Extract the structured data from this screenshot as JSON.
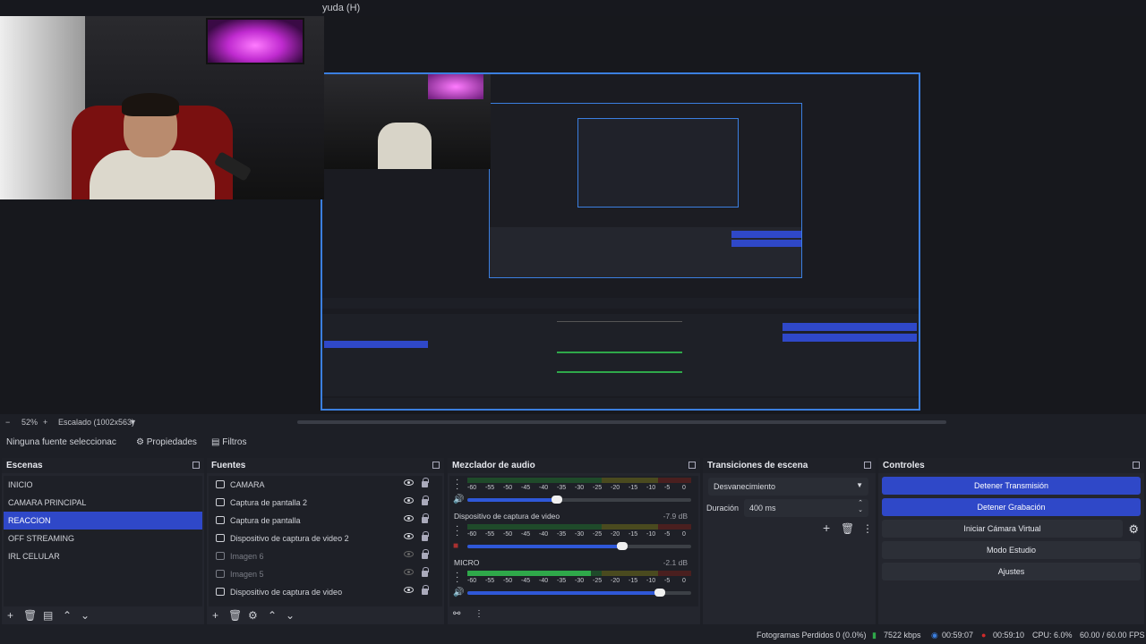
{
  "menu": {
    "help_label": "yuda (H)"
  },
  "preview": {
    "embedded": {
      "scenes": [
        "INICIO",
        "CAMARA PRINCIPAL",
        "REACCION",
        "OFF STREAMING",
        "IRL CELULAR"
      ],
      "no_source": "Ninguna fuente seleccionar",
      "stats": "Fotogramas Perdidos 0 (0.0%)   7522 kbps   00:59:07   00:59:10   CPU: 6.0%   60.00 / 60.00 FPS"
    }
  },
  "zoom": {
    "minus": "−",
    "level": "52%",
    "plus": "+",
    "scale_label": "Escalado (1002x563)",
    "caret": "▼"
  },
  "props": {
    "no_source": "Ninguna fuente seleccionac",
    "properties": "Propiedades",
    "filters": "Filtros"
  },
  "scenes": {
    "title": "Escenas",
    "items": [
      {
        "label": "INICIO"
      },
      {
        "label": "CAMARA PRINCIPAL"
      },
      {
        "label": "REACCION"
      },
      {
        "label": "OFF STREAMING"
      },
      {
        "label": "IRL CELULAR"
      }
    ],
    "selected_index": 2
  },
  "sources": {
    "title": "Fuentes",
    "items": [
      {
        "label": "CAMARA",
        "icon": "camera-icon",
        "visible": true
      },
      {
        "label": "Captura de pantalla 2",
        "icon": "monitor-icon",
        "visible": true
      },
      {
        "label": "Captura de pantalla",
        "icon": "monitor-icon",
        "visible": true
      },
      {
        "label": "Dispositivo de captura de video 2",
        "icon": "camera-icon",
        "visible": true
      },
      {
        "label": "Imagen 6",
        "icon": "image-icon",
        "visible": false
      },
      {
        "label": "Imagen 5",
        "icon": "image-icon",
        "visible": false
      },
      {
        "label": "Dispositivo de captura de video",
        "icon": "camera-icon",
        "visible": true
      }
    ]
  },
  "mixer": {
    "title": "Mezclador de audio",
    "scale": [
      "-60",
      "-55",
      "-50",
      "-45",
      "-40",
      "-35",
      "-30",
      "-25",
      "-20",
      "-15",
      "-10",
      "-5",
      "0"
    ],
    "channels": [
      {
        "name": "",
        "db": "",
        "fader": 0.4,
        "level": 0
      },
      {
        "name": "Dispositivo de captura de video",
        "db": "-7.9 dB",
        "fader": 0.69,
        "level": 0,
        "muted": true
      },
      {
        "name": "MICRO",
        "db": "-2.1 dB",
        "fader": 0.86,
        "level": 0.55
      }
    ]
  },
  "transitions": {
    "title": "Transiciones de escena",
    "selected": "Desvanecimiento",
    "duration_label": "Duración",
    "duration_value": "400 ms"
  },
  "controls": {
    "title": "Controles",
    "buttons": [
      {
        "label": "Detener Transmisión",
        "active": true
      },
      {
        "label": "Detener Grabación",
        "active": true
      },
      {
        "label": "Iniciar Cámara Virtual",
        "active": false
      },
      {
        "label": "Modo Estudio",
        "active": false
      },
      {
        "label": "Ajustes",
        "active": false
      }
    ]
  },
  "status": {
    "dropped": "Fotogramas Perdidos 0 (0.0%)",
    "bitrate": "7522 kbps",
    "stream_time": "00:59:07",
    "rec_time": "00:59:10",
    "cpu": "CPU: 6.0%",
    "fps": "60.00 / 60.00 FPS"
  },
  "colors": {
    "accent": "#2f48c8",
    "preview_border": "#3b7fe0",
    "meter_green": "#2fa84a",
    "meter_yellow": "#a8a030",
    "meter_red": "#a83030"
  }
}
